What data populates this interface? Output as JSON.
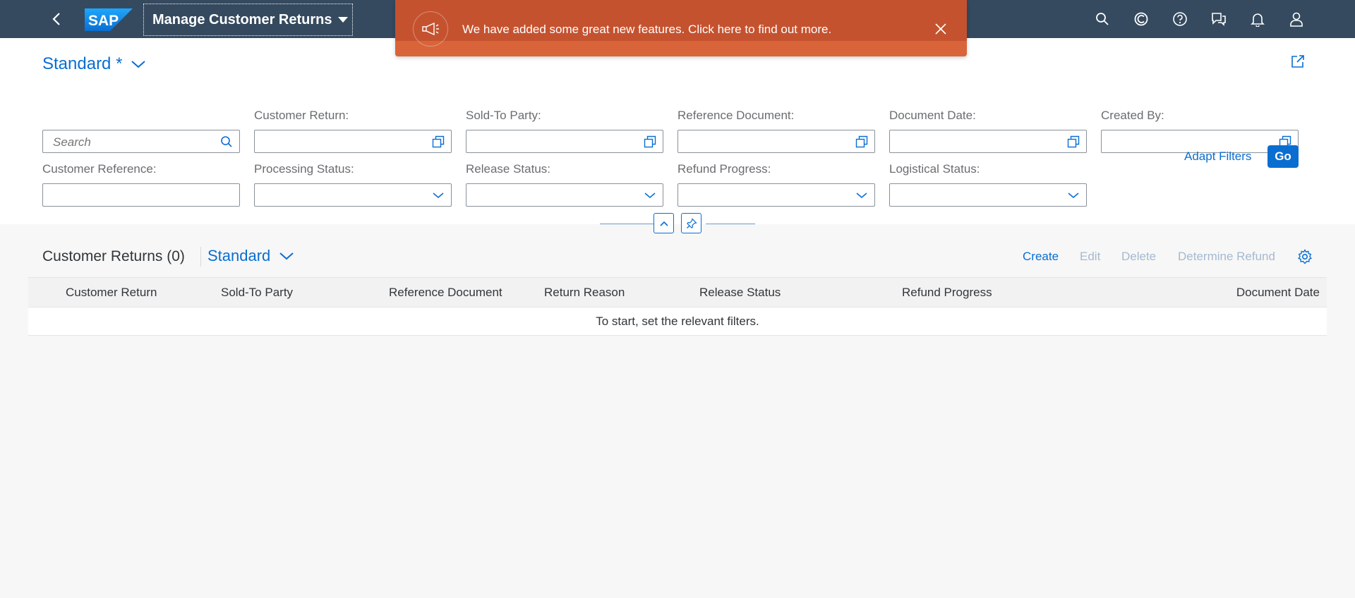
{
  "shell": {
    "app_title": "Manage Customer Returns",
    "logo_text": "SAP",
    "icons": [
      "back-icon",
      "search-icon",
      "copilot-icon",
      "help-icon",
      "feedback-icon",
      "notifications-icon",
      "user-icon"
    ]
  },
  "notification": {
    "message": "We have added some great new features. Click here to find out more.",
    "icon": "megaphone-icon"
  },
  "variant": {
    "label": "Standard *"
  },
  "filters": {
    "search_placeholder": "Search",
    "labels": {
      "customer_return": "Customer Return:",
      "sold_to_party": "Sold-To Party:",
      "reference_document": "Reference Document:",
      "document_date": "Document Date:",
      "created_by": "Created By:",
      "customer_reference": "Customer Reference:",
      "processing_status": "Processing Status:",
      "release_status": "Release Status:",
      "refund_progress": "Refund Progress:",
      "logistical_status": "Logistical Status:"
    },
    "adapt_filters": "Adapt Filters",
    "go": "Go"
  },
  "table": {
    "title": "Customer Returns (0)",
    "variant": "Standard",
    "actions": {
      "create": "Create",
      "edit": "Edit",
      "delete": "Delete",
      "determine_refund": "Determine Refund"
    },
    "columns": [
      "Customer Return",
      "Sold-To Party",
      "Reference Document",
      "Return Reason",
      "Release Status",
      "Refund Progress",
      "Document Date"
    ],
    "no_data": "To start, set the relevant filters."
  },
  "colors": {
    "shell": "#354a5f",
    "accent": "#0a6ed1",
    "notification": "#c5522f",
    "background": "#f7f7f7"
  }
}
